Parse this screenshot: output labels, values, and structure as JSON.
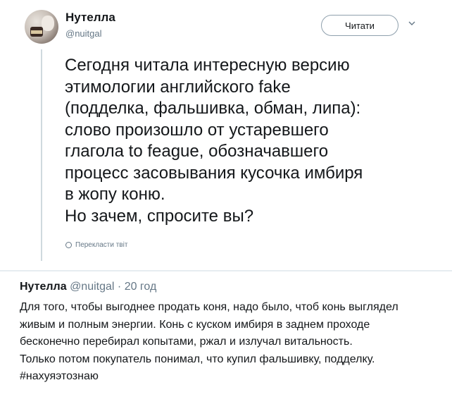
{
  "tweet": {
    "author_name": "Нутелла",
    "author_handle": "@nuitgal",
    "follow_label": "Читати",
    "body_lines": [
      "Сегодня читала интересную версию",
      "этимологии английского fake",
      "(подделка, фальшивка, обман, липа):",
      "слово произошло от устаревшего",
      "глагола to feague, обозначавшего",
      "процесс засовывания кусочка имбиря",
      "в жопу коню.",
      "Но зачем, спросите вы?"
    ],
    "translate_label": "Перекласти твіт"
  },
  "reply": {
    "author_name": "Нутелла",
    "author_handle": "@nuitgal",
    "separator": "·",
    "time": "20 год",
    "body_lines": [
      "Для того, чтобы выгоднее продать коня, надо было, чтоб конь выглядел",
      "живым и полным энергии. Конь с куском имбиря в заднем проходе",
      "бесконечно перебирал копытами, ржал и излучал витальность.",
      "Только потом покупатель понимал, что купил фальшивку, подделку.",
      "#нахуяэтознаю"
    ]
  },
  "icons": {
    "chevron": "chevron-down-icon",
    "globe": "globe-icon"
  }
}
